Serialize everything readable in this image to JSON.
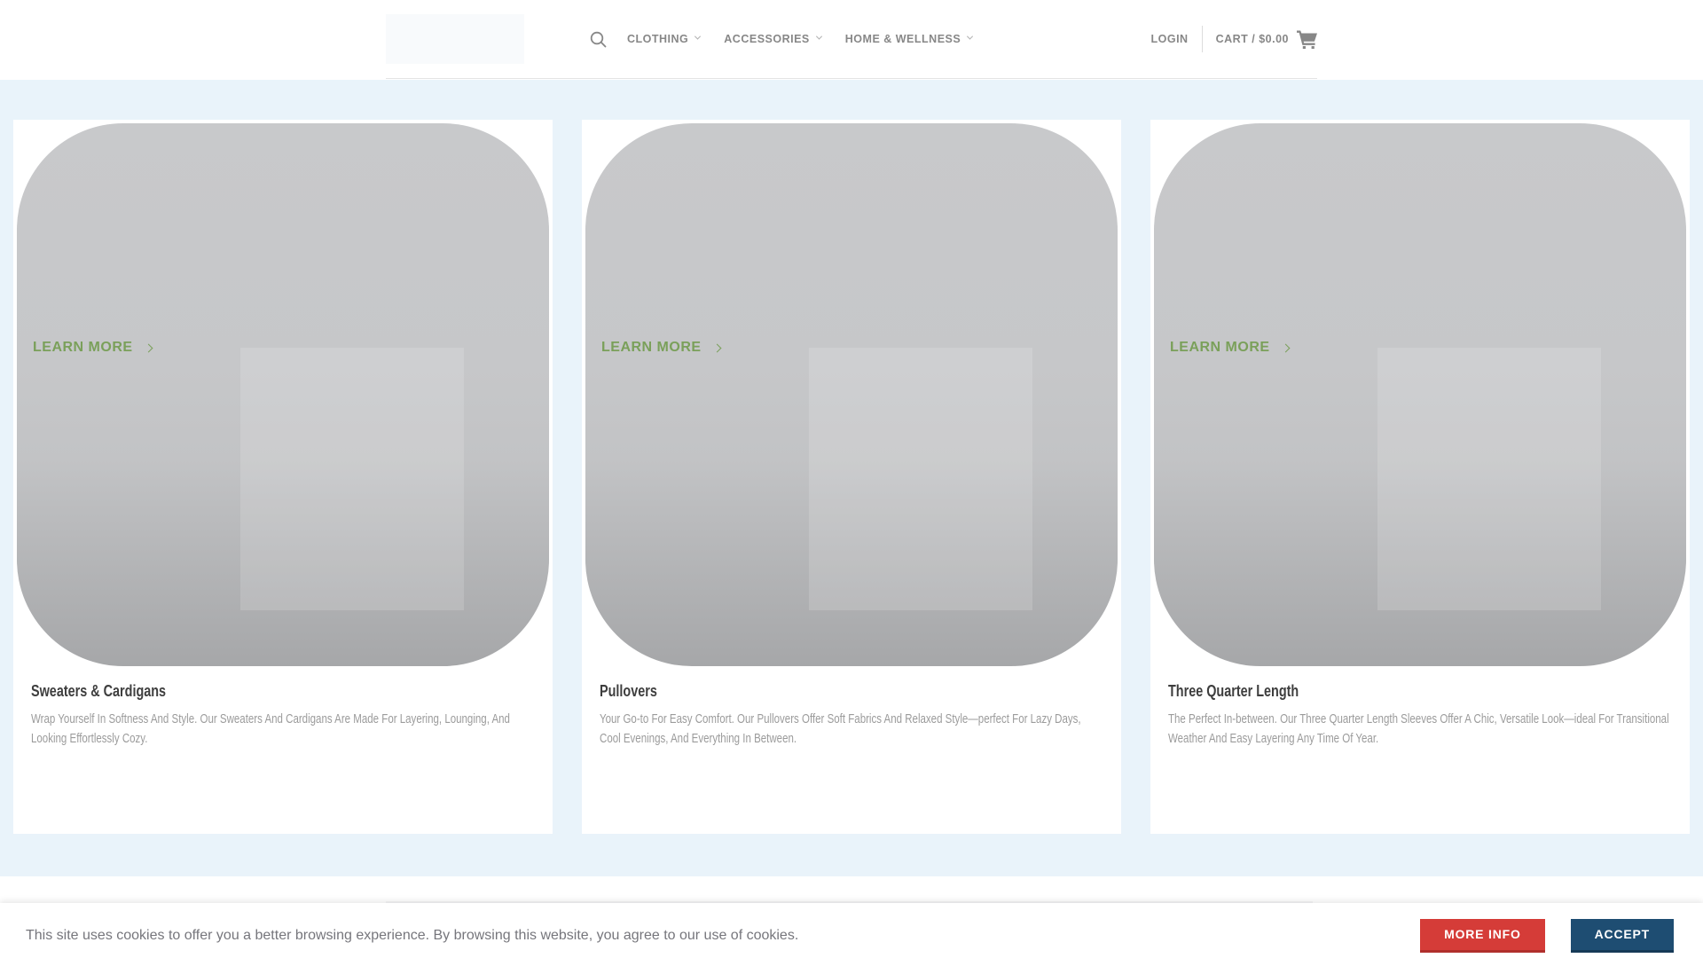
{
  "header": {
    "nav_items": [
      {
        "label": "CLOTHING"
      },
      {
        "label": "ACCESSORIES"
      },
      {
        "label": "HOME & WELLNESS"
      }
    ],
    "login_label": "LOGIN",
    "cart_label": "CART / $0.00",
    "icons": {
      "search": "search-icon",
      "cart": "shopping-cart-icon",
      "dropdown": "chevron-down-icon"
    }
  },
  "cards": [
    {
      "title": "Sweaters & Cardigans",
      "description": "Wrap Yourself In Softness And Style. Our Sweaters And Cardigans Are Made For Layering, Lounging, And Looking Effortlessly Cozy.",
      "cta": "LEARN MORE"
    },
    {
      "title": "Pullovers",
      "description": "Your Go-to For Easy Comfort. Our Pullovers Offer Soft Fabrics And Relaxed Style—perfect For Lazy Days, Cool Evenings, And Everything In Between.",
      "cta": "LEARN MORE"
    },
    {
      "title": "Three Quarter Length",
      "description": "The Perfect In-between. Our Three Quarter Length Sleeves Offer A Chic, Versatile Look—ideal For Transitional Weather And Easy Layering Any Time Of Year.",
      "cta": "LEARN MORE"
    }
  ],
  "cookie_notice": {
    "message": "This site uses cookies to offer you a better browsing experience. By browsing this website, you agree to our use of cookies.",
    "more_info_label": "MORE INFO",
    "accept_label": "ACCEPT"
  },
  "colors": {
    "accent_green": "#7aa05a",
    "more_info_red": "#d53c38",
    "accept_navy": "#1e4d72",
    "section_blue": "#e9f3fa"
  }
}
